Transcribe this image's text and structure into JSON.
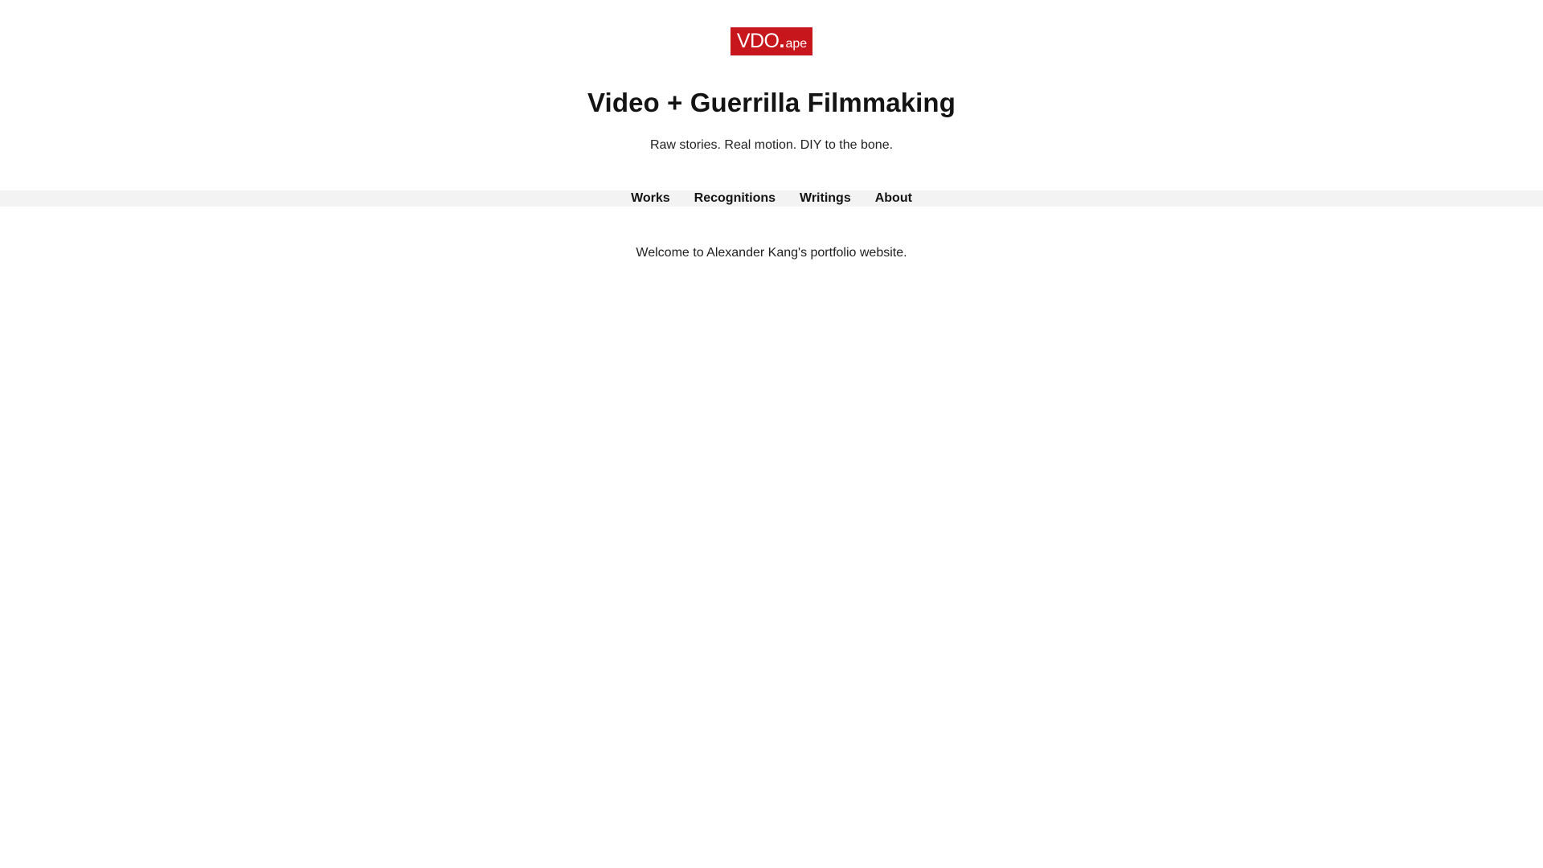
{
  "logo": {
    "main": "VDO",
    "dot": ".",
    "sub": "ape",
    "bg_color": "#c8161d"
  },
  "header": {
    "title": "Video + Guerrilla Filmmaking",
    "tagline": "Raw stories. Real motion. DIY to the bone."
  },
  "nav": {
    "items": [
      {
        "label": "Works"
      },
      {
        "label": "Recognitions"
      },
      {
        "label": "Writings"
      },
      {
        "label": "About"
      }
    ]
  },
  "main": {
    "welcome": "Welcome to Alexander Kang's portfolio website."
  }
}
